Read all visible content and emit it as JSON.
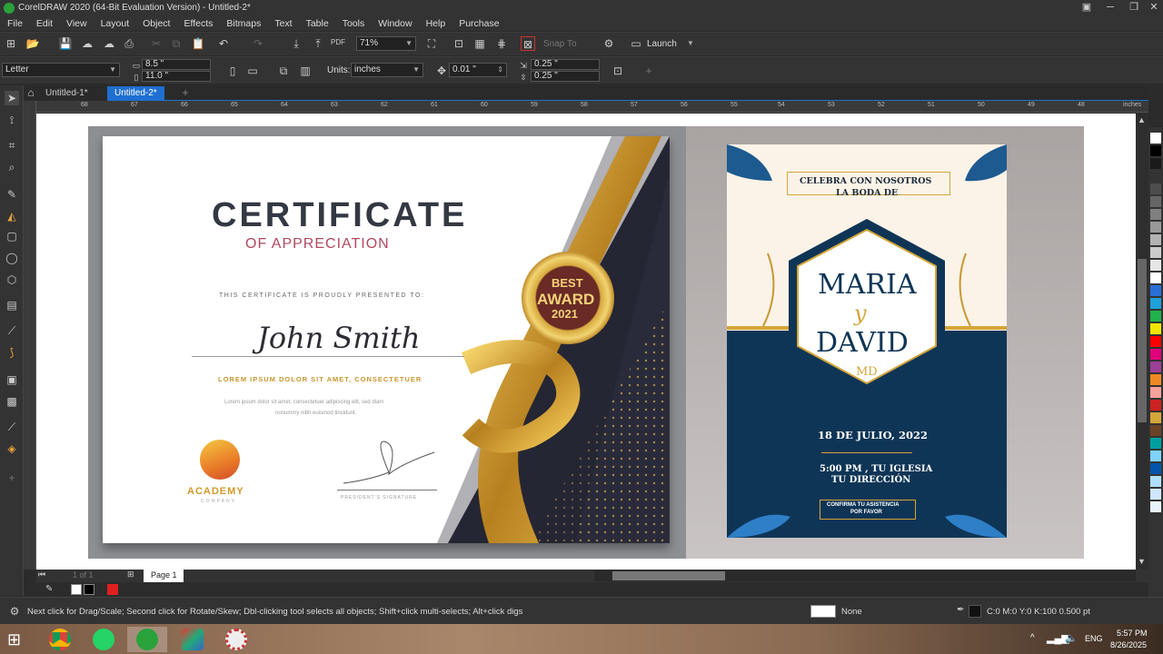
{
  "app": {
    "title": "CorelDRAW 2020 (64-Bit Evaluation Version) - Untitled-2*"
  },
  "menu": [
    "File",
    "Edit",
    "View",
    "Layout",
    "Object",
    "Effects",
    "Bitmaps",
    "Text",
    "Table",
    "Tools",
    "Window",
    "Help",
    "Purchase"
  ],
  "toolbar": {
    "zoom_value": "71%",
    "snap_label": "Snap To",
    "launch_label": "Launch",
    "pdf_label": "PDF"
  },
  "property_bar": {
    "page_size": "Letter",
    "width": "8.5 \"",
    "height": "11.0 \"",
    "units_label": "Units:",
    "units_value": "inches",
    "nudge": "0.01 \"",
    "dup_x": "0.25 \"",
    "dup_y": "0.25 \""
  },
  "tabs": [
    {
      "label": "Untitled-1*",
      "active": false
    },
    {
      "label": "Untitled-2*",
      "active": true
    }
  ],
  "ruler": {
    "ticks": [
      "68",
      "67",
      "66",
      "65",
      "64",
      "63",
      "62",
      "61",
      "60",
      "59",
      "58",
      "57",
      "56",
      "55",
      "54",
      "53",
      "52",
      "51",
      "50",
      "49",
      "48"
    ],
    "unit": "inches"
  },
  "certificate": {
    "title": "CERTIFICATE",
    "subtitle": "OF APPRECIATION",
    "presented": "THIS CERTIFICATE IS PROUDLY PRESENTED TO:",
    "name": "John Smith",
    "lorem_title": "LOREM IPSUM DOLOR SIT AMET, CONSECTETUER",
    "lorem_body_1": "Lorem ipsum dolor sit amet, consectetuer adipiscing elit, sed diam",
    "lorem_body_2": "nonummy nibh euismod tincidunt.",
    "badge_line1": "BEST",
    "badge_line2": "AWARD",
    "badge_line3": "2021",
    "academy": "ACADEMY",
    "company": "COMPANY",
    "signature_label": "PRESIDENT'S SIGNATURE"
  },
  "invitation": {
    "header_1": "CELEBRA CON NOSOTROS",
    "header_2": "LA BODA DE",
    "name_1": "MARIA",
    "and": "y",
    "name_2": "DAVID",
    "monogram": "MD",
    "date": "18 DE JULIO, 2022",
    "time_place_1": "5:00 PM , TU IGLESIA",
    "time_place_2": "TU DIRECCIÓN",
    "confirm_1": "CONFIRMA TU ASISTENCIA",
    "confirm_2": "POR FAVOR"
  },
  "pagebar": {
    "pages": "1 of 1",
    "page_tab": "Page 1"
  },
  "statusbar": {
    "hint": "Next click for Drag/Scale; Second click for Rotate/Skew; Dbl-clicking tool selects all objects; Shift+click multi-selects; Alt+click digs",
    "fill_label": "None",
    "outline_info": "C:0 M:0 Y:0 K:100  0.500 pt"
  },
  "taskbar": {
    "lang": "ENG",
    "time": "5:57 PM",
    "date": "8/26/2025"
  },
  "colors": {
    "accent_blue": "#1f6fd1",
    "gold": "#d4a63a",
    "navy": "#0f3556",
    "dark_ui": "#333333"
  },
  "palette": [
    "#ffffff",
    "#000000",
    "#1a1a1a",
    "#333333",
    "#4d4d4d",
    "#666666",
    "#808080",
    "#999999",
    "#b3b3b3",
    "#cccccc",
    "#e6e6e6",
    "#ffffff",
    "#2a6fd6",
    "#1ea0d8",
    "#22b14c",
    "#f2e600",
    "#ff0000",
    "#e0007a",
    "#9c3f98",
    "#f08a24",
    "#f6a19c",
    "#cc2222",
    "#d4a63a",
    "#6b4226",
    "#00a0a0",
    "#7fd3ff",
    "#0055aa",
    "#b0e0ff",
    "#cfe8ff",
    "#e8f4ff"
  ]
}
